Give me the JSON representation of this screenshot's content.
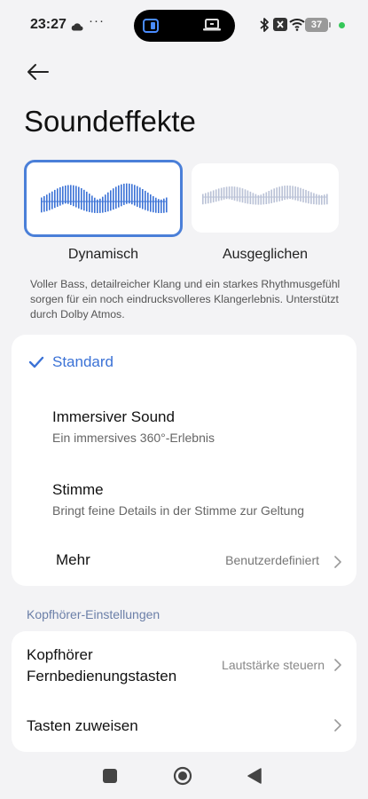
{
  "status_bar": {
    "time": "23:27",
    "dots": "···",
    "battery": "37"
  },
  "header": {
    "title": "Soundeffekte"
  },
  "effects": [
    {
      "label": "Dynamisch",
      "selected": true
    },
    {
      "label": "Ausgeglichen",
      "selected": false
    }
  ],
  "description": "Voller Bass, detailreicher Klang und ein starkes Rhythmusgefühl sorgen für ein noch eindrucksvolleres Klangerlebnis. Unterstützt durch Dolby Atmos.",
  "modes": {
    "selected": "Standard",
    "items": [
      {
        "title": "Immersiver Sound",
        "subtitle": "Ein immersives 360°-Erlebnis"
      },
      {
        "title": "Stimme",
        "subtitle": "Bringt feine Details in der Stimme zur Geltung"
      }
    ],
    "more_label": "Mehr",
    "more_value": "Benutzerdefiniert"
  },
  "headset_section": {
    "header": "Kopfhörer-Einstellungen",
    "remote_title_line1": "Kopfhörer",
    "remote_title_line2": "Fernbedienungstasten",
    "remote_value": "Lautstärke steuern",
    "assign_title": "Tasten zuweisen"
  },
  "colors": {
    "accent": "#3b72d6",
    "background": "#f3f3f5"
  }
}
